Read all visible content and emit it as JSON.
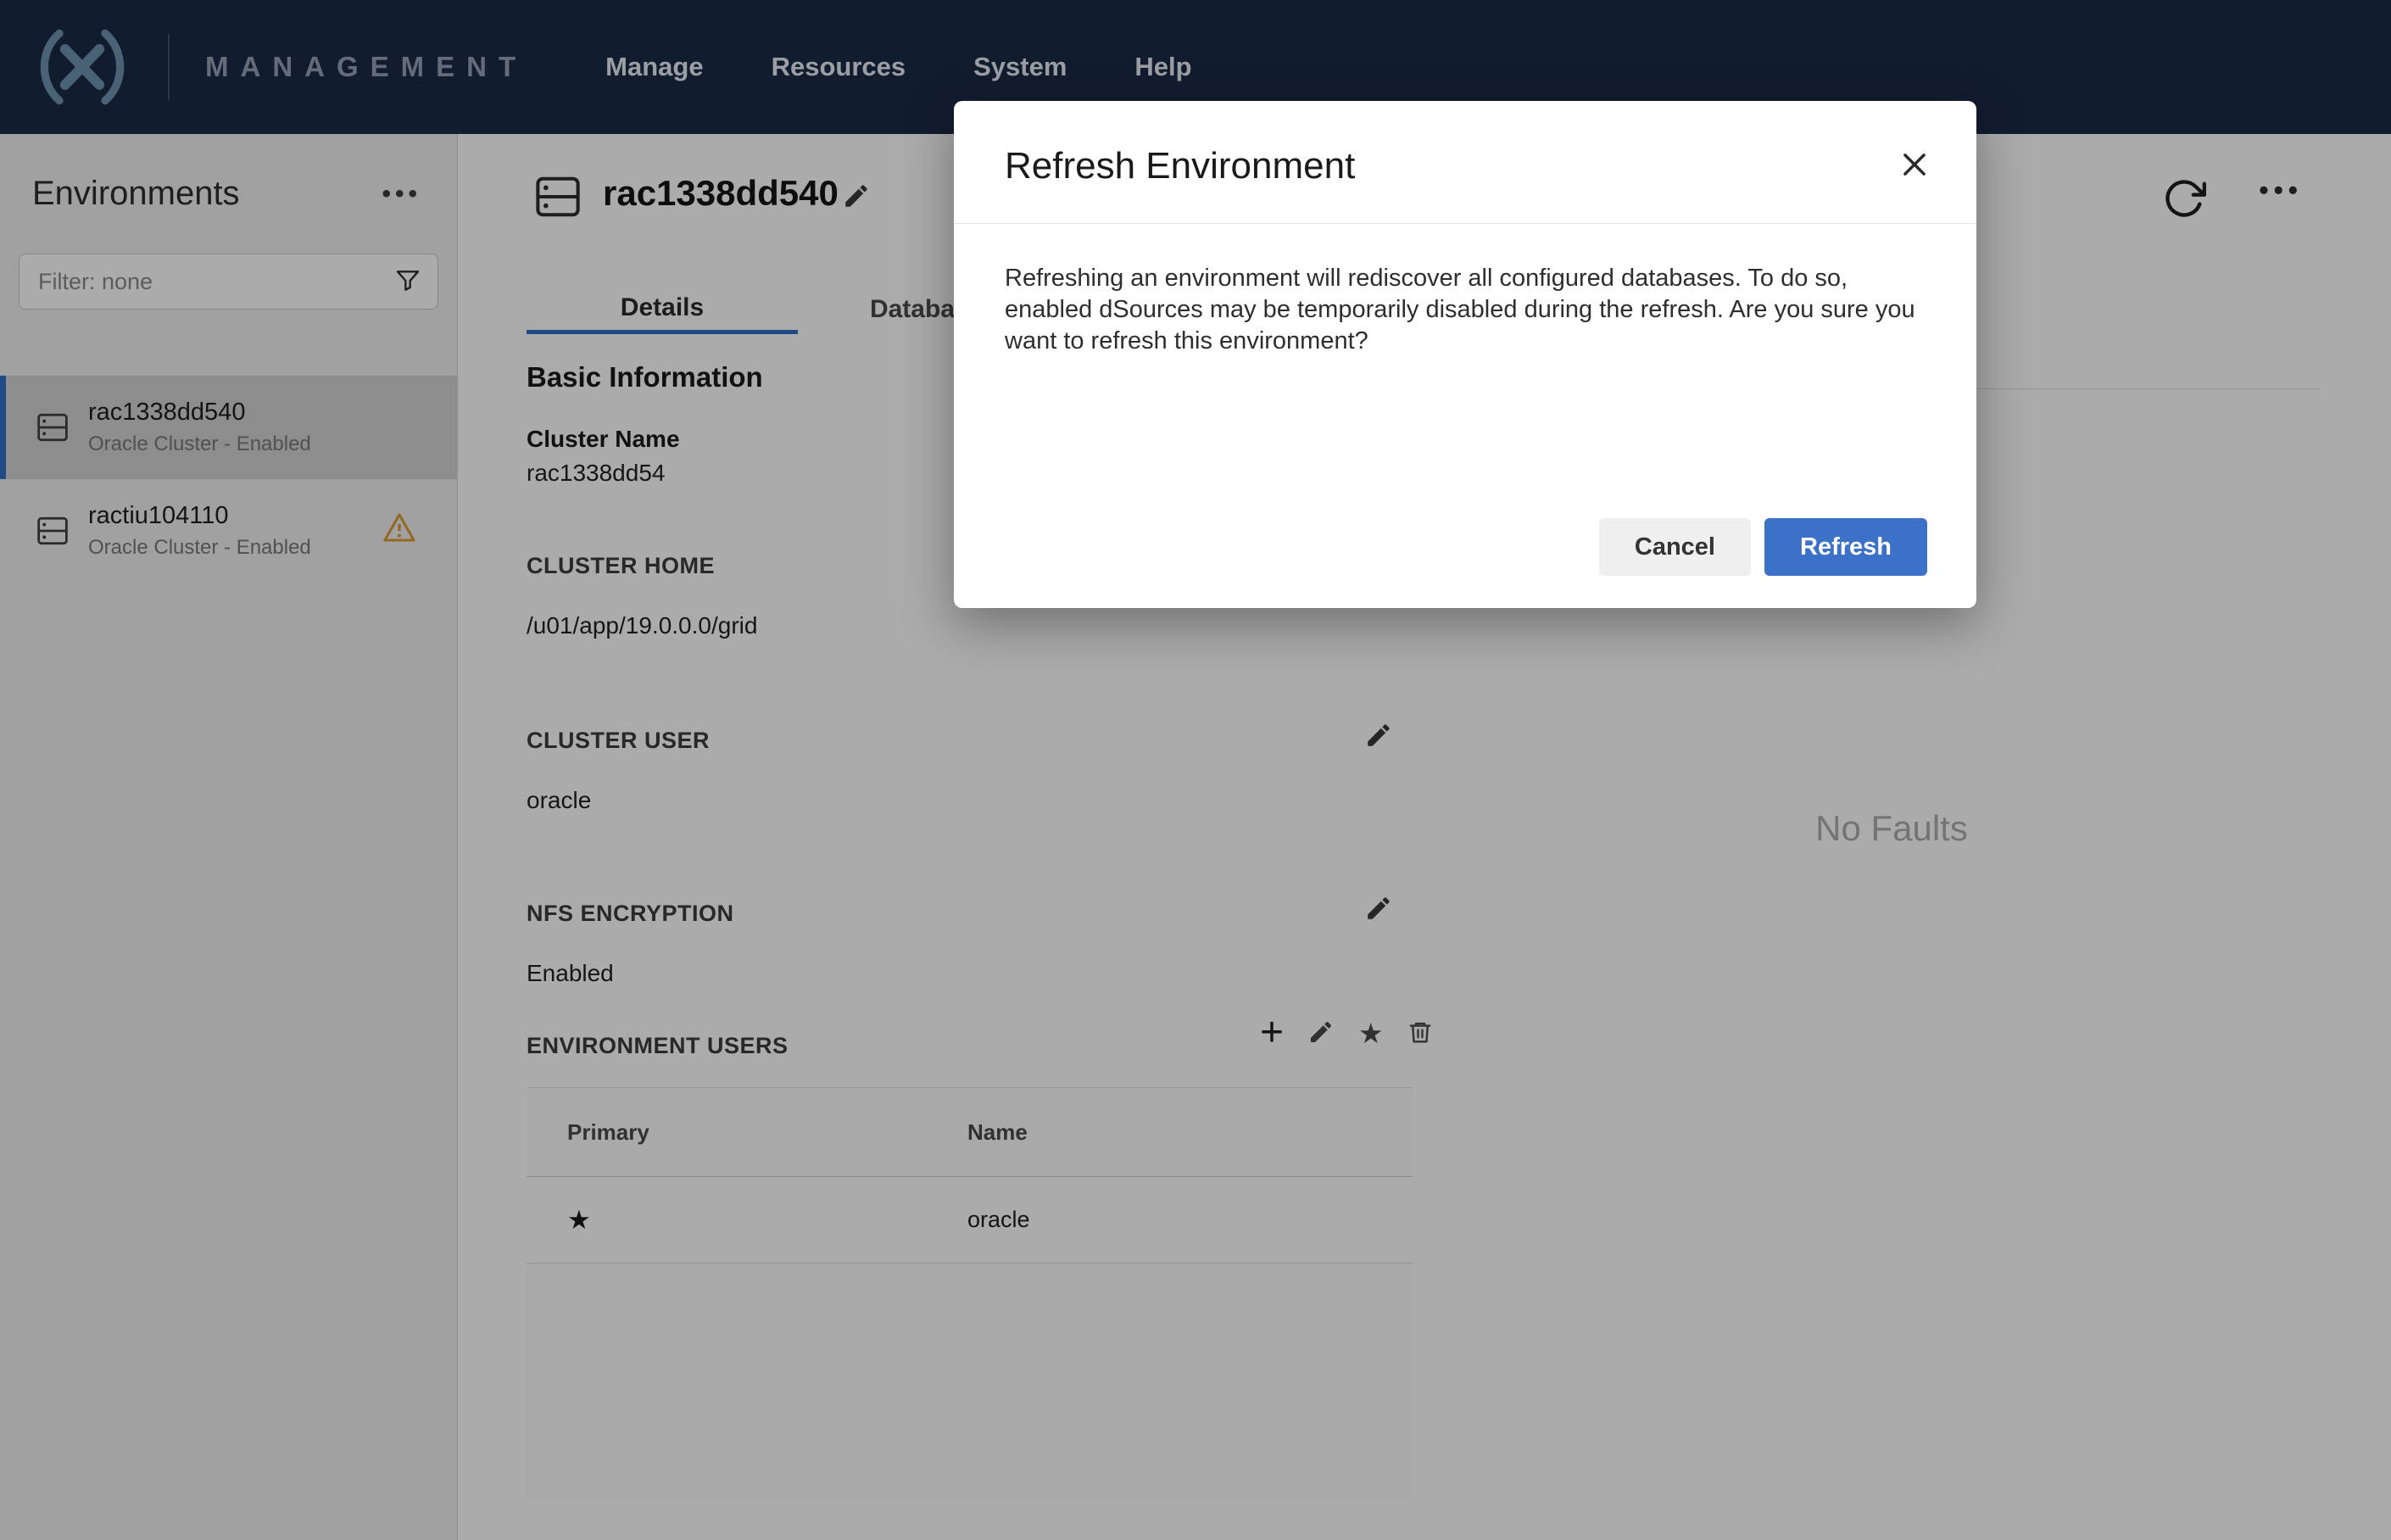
{
  "colors": {
    "accent": "#2D71C4",
    "accent_btn": "#3B72C8",
    "nav_bg": "#1B2B47",
    "warning": "#DD9A33"
  },
  "icons": {
    "ellipsis": "•••",
    "plus": "+",
    "star_filled": "★"
  },
  "nav": {
    "brand": "MANAGEMENT",
    "items": [
      {
        "label": "Manage"
      },
      {
        "label": "Resources"
      },
      {
        "label": "System"
      },
      {
        "label": "Help"
      }
    ]
  },
  "sidebar": {
    "title": "Environments",
    "filter_placeholder": "Filter: none",
    "items": [
      {
        "name": "rac1338dd540",
        "subtitle": "Oracle Cluster - Enabled",
        "selected": true,
        "warning": false
      },
      {
        "name": "ractiu104110",
        "subtitle": "Oracle Cluster - Enabled",
        "selected": false,
        "warning": true
      }
    ]
  },
  "main": {
    "title": "rac1338dd540",
    "tabs": [
      {
        "label": "Details",
        "active": true
      },
      {
        "label": "Databases",
        "active": false
      }
    ],
    "sections": {
      "basic_info_title": "Basic Information",
      "cluster_name_label": "Cluster Name",
      "cluster_name_value": "rac1338dd54",
      "cluster_home_label": "CLUSTER HOME",
      "cluster_home_value": "/u01/app/19.0.0.0/grid",
      "cluster_user_label": "CLUSTER USER",
      "cluster_user_value": "oracle",
      "nfs_label": "NFS ENCRYPTION",
      "nfs_value": "Enabled",
      "env_users_label": "ENVIRONMENT USERS"
    },
    "users_table": {
      "headers": [
        "Primary",
        "Name"
      ],
      "rows": [
        {
          "primary": true,
          "name": "oracle"
        }
      ]
    },
    "faults": {
      "empty_text": "No Faults"
    }
  },
  "modal": {
    "title": "Refresh Environment",
    "body": "Refreshing an environment will rediscover all configured databases. To do so, enabled dSources may be temporarily disabled during the refresh. Are you sure you want to refresh this environment?",
    "cancel_label": "Cancel",
    "confirm_label": "Refresh"
  }
}
